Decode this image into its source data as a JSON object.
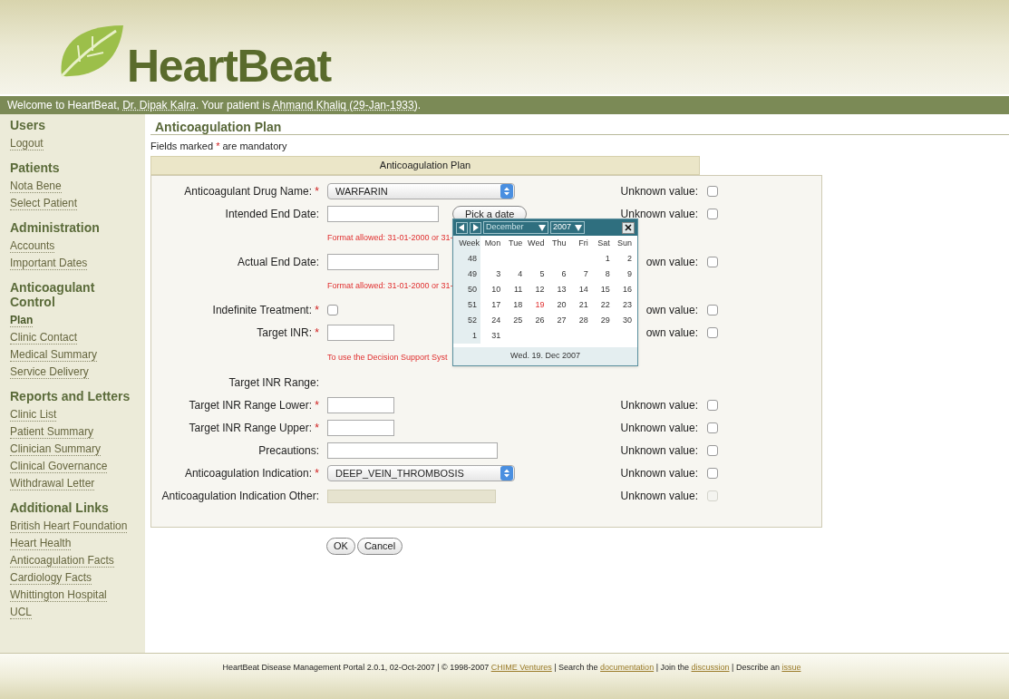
{
  "header": {
    "logo_text": "HeartBeat"
  },
  "welcome": [
    {
      "kind": "text",
      "text": "Welcome to HeartBeat, "
    },
    {
      "kind": "link",
      "text": "Dr. Dipak Kalra"
    },
    {
      "kind": "text",
      "text": ". Your patient is "
    },
    {
      "kind": "link",
      "text": "Ahmand Khaliq (29-Jan-1933)"
    },
    {
      "kind": "text",
      "text": "."
    }
  ],
  "sidebar": {
    "sections": [
      {
        "title": "Users",
        "items": [
          {
            "label": "Logout",
            "selected": false
          }
        ]
      },
      {
        "title": "Patients",
        "items": [
          {
            "label": "Nota Bene",
            "selected": false
          },
          {
            "label": "Select Patient",
            "selected": false
          }
        ]
      },
      {
        "title": "Administration",
        "items": [
          {
            "label": "Accounts",
            "selected": false
          },
          {
            "label": "Important Dates",
            "selected": false
          }
        ]
      },
      {
        "title": "Anticoagulant Control",
        "items": [
          {
            "label": "Plan",
            "selected": true
          },
          {
            "label": "Clinic Contact",
            "selected": false
          },
          {
            "label": "Medical Summary",
            "selected": false
          },
          {
            "label": "Service Delivery",
            "selected": false
          }
        ]
      },
      {
        "title": "Reports and Letters",
        "items": [
          {
            "label": "Clinic List",
            "selected": false
          },
          {
            "label": "Patient Summary",
            "selected": false
          },
          {
            "label": "Clinician Summary",
            "selected": false
          },
          {
            "label": "Clinical Governance",
            "selected": false
          },
          {
            "label": "Withdrawal Letter",
            "selected": false
          }
        ]
      },
      {
        "title": "Additional Links",
        "items": [
          {
            "label": "British Heart Foundation",
            "selected": false
          },
          {
            "label": "Heart Health",
            "selected": false
          },
          {
            "label": "Anticoagulation Facts",
            "selected": false
          },
          {
            "label": "Cardiology Facts",
            "selected": false
          },
          {
            "label": "Whittington Hospital",
            "selected": false
          },
          {
            "label": "UCL",
            "selected": false
          }
        ]
      }
    ]
  },
  "page_title": "Anticoagulation Plan",
  "mandatory_note": {
    "before": "Fields marked",
    "mark": "*",
    "after": "are mandatory"
  },
  "form": {
    "title": "Anticoagulation Plan",
    "rows": [
      {
        "kind": "select",
        "label": "Anticoagulant Drug Name:",
        "required": true,
        "value": "WARFARIN",
        "unknown": {
          "label": "Unknown value:",
          "checked": false,
          "disabled": false
        }
      },
      {
        "kind": "date",
        "label": "Intended End Date:",
        "required": false,
        "button": "Pick a date",
        "unknown": {
          "label": "Unknown value:",
          "checked": false,
          "disabled": false
        }
      },
      {
        "kind": "note",
        "text": "Format allowed: 31-01-2000 or 31-"
      },
      {
        "kind": "date",
        "label": "Actual End Date:",
        "required": false,
        "unknown": {
          "label": "own value:",
          "checked": false,
          "disabled": false
        }
      },
      {
        "kind": "note",
        "text": "Format allowed: 31-01-2000 or 31-"
      },
      {
        "kind": "checkbox",
        "label": "Indefinite Treatment:",
        "required": true,
        "checked": false,
        "unknown": {
          "label": "own value:",
          "checked": false,
          "disabled": false
        }
      },
      {
        "kind": "number",
        "label": "Target INR:",
        "required": true,
        "unknown": {
          "label": "own value:",
          "checked": false,
          "disabled": false
        }
      },
      {
        "kind": "note",
        "text": "To use the Decision Support Syst"
      },
      {
        "kind": "heading",
        "label": "Target INR Range:",
        "required": false
      },
      {
        "kind": "number",
        "label": "Target INR Range Lower:",
        "required": true,
        "unknown": {
          "label": "Unknown value:",
          "checked": false,
          "disabled": false
        }
      },
      {
        "kind": "number",
        "label": "Target INR Range Upper:",
        "required": true,
        "unknown": {
          "label": "Unknown value:",
          "checked": false,
          "disabled": false
        }
      },
      {
        "kind": "text",
        "label": "Precautions:",
        "required": false,
        "unknown": {
          "label": "Unknown value:",
          "checked": false,
          "disabled": false
        }
      },
      {
        "kind": "select",
        "label": "Anticoagulation Indication:",
        "required": true,
        "value": "DEEP_VEIN_THROMBOSIS",
        "unknown": {
          "label": "Unknown value:",
          "checked": false,
          "disabled": false
        }
      },
      {
        "kind": "disabled-text",
        "label": "Anticoagulation Indication Other:",
        "required": false,
        "unknown": {
          "label": "Unknown value:",
          "checked": false,
          "disabled": true
        }
      }
    ]
  },
  "calendar": {
    "month": "December",
    "year": "2007",
    "headings": [
      "Week",
      "Mon",
      "Tue",
      "Wed",
      "Thu",
      "Fri",
      "Sat",
      "Sun"
    ],
    "weeks": [
      {
        "week": "48",
        "days": [
          {
            "day": "1",
            "selected": false
          },
          {
            "day": "2",
            "selected": false
          }
        ]
      },
      {
        "week": "49",
        "days": [
          {
            "day": "3",
            "selected": false
          },
          {
            "day": "4",
            "selected": false
          },
          {
            "day": "5",
            "selected": false
          },
          {
            "day": "6",
            "selected": false
          },
          {
            "day": "7",
            "selected": false
          },
          {
            "day": "8",
            "selected": false
          },
          {
            "day": "9",
            "selected": false
          }
        ]
      },
      {
        "week": "50",
        "days": [
          {
            "day": "10",
            "selected": false
          },
          {
            "day": "11",
            "selected": false
          },
          {
            "day": "12",
            "selected": false
          },
          {
            "day": "13",
            "selected": false
          },
          {
            "day": "14",
            "selected": false
          },
          {
            "day": "15",
            "selected": false
          },
          {
            "day": "16",
            "selected": false
          }
        ]
      },
      {
        "week": "51",
        "days": [
          {
            "day": "17",
            "selected": false
          },
          {
            "day": "18",
            "selected": false
          },
          {
            "day": "19",
            "selected": true
          },
          {
            "day": "20",
            "selected": false
          },
          {
            "day": "21",
            "selected": false
          },
          {
            "day": "22",
            "selected": false
          },
          {
            "day": "23",
            "selected": false
          }
        ]
      },
      {
        "week": "52",
        "days": [
          {
            "day": "24",
            "selected": false
          },
          {
            "day": "25",
            "selected": false
          },
          {
            "day": "26",
            "selected": false
          },
          {
            "day": "27",
            "selected": false
          },
          {
            "day": "28",
            "selected": false
          },
          {
            "day": "29",
            "selected": false
          },
          {
            "day": "30",
            "selected": false
          }
        ]
      },
      {
        "week": "1",
        "days": [
          {
            "day": "31",
            "selected": false
          }
        ]
      }
    ],
    "footer": "Wed. 19. Dec 2007"
  },
  "buttons": [
    "OK",
    "Cancel"
  ],
  "footer": [
    {
      "kind": "text",
      "text": "HeartBeat Disease Management Portal 2.0.1, 02-Oct-2007 | © 1998-2007 "
    },
    {
      "kind": "link",
      "text": "CHIME Ventures"
    },
    {
      "kind": "text",
      "text": " | Search the "
    },
    {
      "kind": "link",
      "text": "documentation"
    },
    {
      "kind": "text",
      "text": " | Join the "
    },
    {
      "kind": "link",
      "text": "discussion"
    },
    {
      "kind": "text",
      "text": " | Describe an "
    },
    {
      "kind": "link",
      "text": "issue"
    }
  ]
}
